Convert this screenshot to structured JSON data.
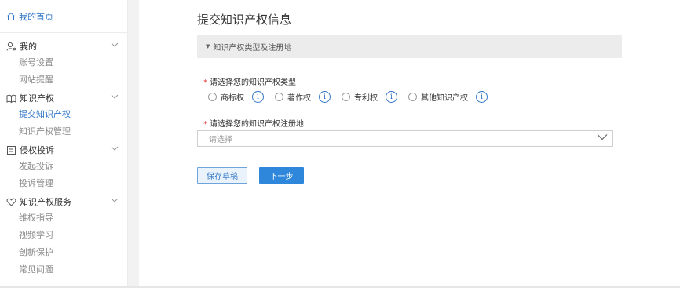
{
  "sidebar": {
    "home": {
      "label": "我的首页",
      "icon": "home-icon"
    },
    "groups": [
      {
        "label": "我的",
        "icon": "user-icon",
        "items": [
          "账号设置",
          "网站提醒"
        ]
      },
      {
        "label": "知识产权",
        "icon": "book-icon",
        "items": [
          "提交知识产权",
          "知识产权管理"
        ],
        "active_index": 0
      },
      {
        "label": "侵权投诉",
        "icon": "complaint-icon",
        "items": [
          "发起投诉",
          "投诉管理"
        ]
      },
      {
        "label": "知识产权服务",
        "icon": "heart-icon",
        "items": [
          "维权指导",
          "视频学习",
          "创新保护",
          "常见问题"
        ]
      }
    ]
  },
  "main": {
    "title": "提交知识产权信息",
    "section_label": "知识产权类型及注册地",
    "type_field": {
      "required_mark": "*",
      "label": "请选择您的知识产权类型",
      "options": [
        "商标权",
        "著作权",
        "专利权",
        "其他知识产权"
      ]
    },
    "region_field": {
      "required_mark": "*",
      "label": "请选择您的知识产权注册地",
      "placeholder": "请选择"
    },
    "buttons": {
      "save_draft": "保存草稿",
      "next": "下一步"
    }
  },
  "colors": {
    "accent": "#2f75c7",
    "primary_button": "#2f87db",
    "required": "#e03b3b",
    "section_bg": "#ececec"
  }
}
